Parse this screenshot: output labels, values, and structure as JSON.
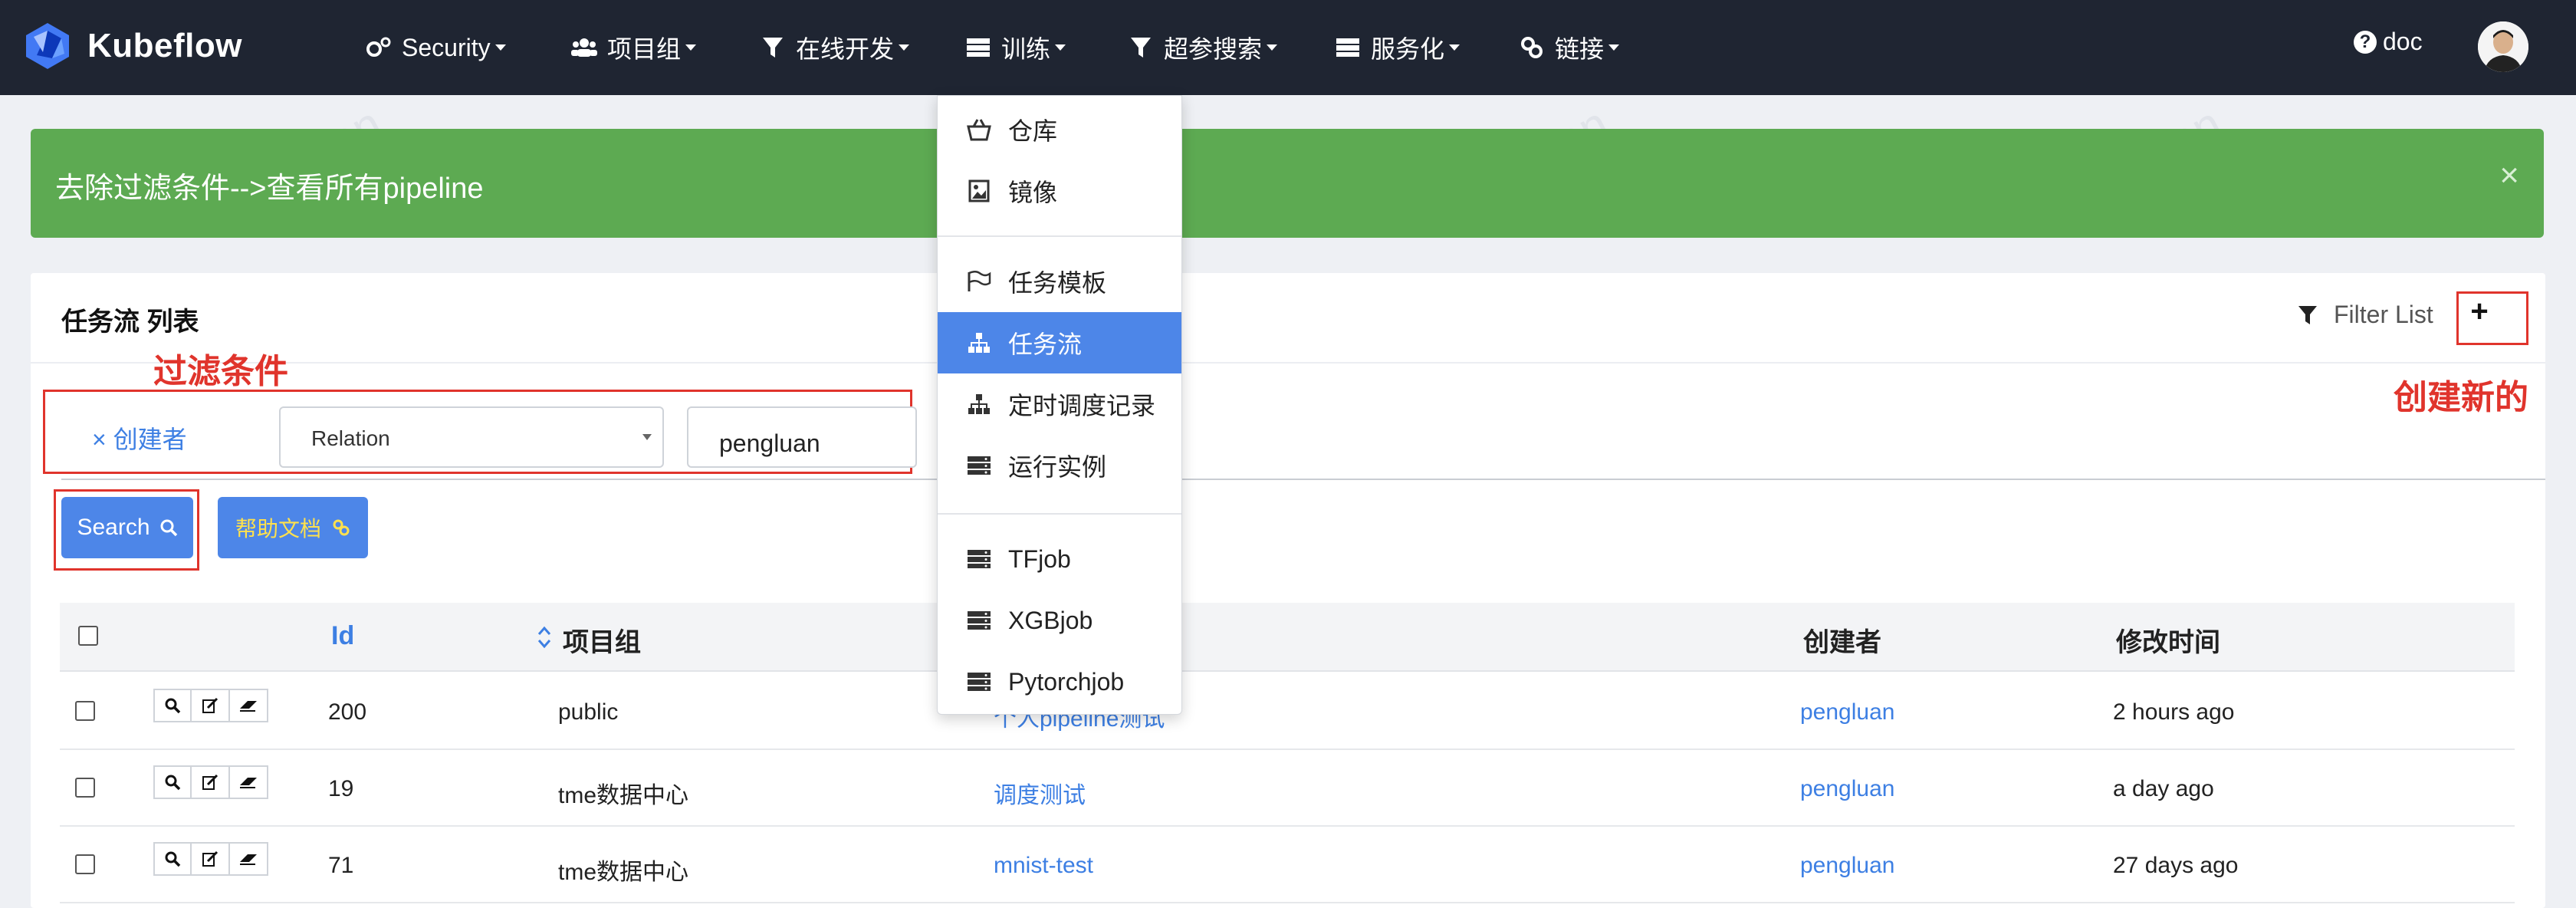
{
  "app": {
    "brand": "Kubeflow",
    "colors": {
      "navbar": "#1f2532",
      "accent": "#4d86e8",
      "alert": "#5daa52",
      "annotation": "#e0342c"
    }
  },
  "nav": {
    "items": [
      {
        "label": "Security",
        "icon": "gears-icon"
      },
      {
        "label": "项目组",
        "icon": "users-icon"
      },
      {
        "label": "在线开发",
        "icon": "filter-icon"
      },
      {
        "label": "训练",
        "icon": "server-icon"
      },
      {
        "label": "超参搜索",
        "icon": "filter-icon"
      },
      {
        "label": "服务化",
        "icon": "server-icon"
      },
      {
        "label": "链接",
        "icon": "link-icon"
      }
    ],
    "doc_label": "doc"
  },
  "alert": {
    "text": "去除过滤条件-->查看所有pipeline",
    "close": "×"
  },
  "panel": {
    "title": "任务流 列表",
    "filter_list_label": "Filter List",
    "add_label": "+"
  },
  "annotations": {
    "filter": "过滤条件",
    "create": "创建新的"
  },
  "filter": {
    "chip_label": "× 创建者",
    "relation_value": "Relation",
    "input_value": "pengluan"
  },
  "buttons": {
    "search": "Search",
    "help": "帮助文档"
  },
  "table": {
    "headers": {
      "id": "Id",
      "project": "项目组",
      "creator": "创建者",
      "modified": "修改时间"
    },
    "rows": [
      {
        "id": "200",
        "project": "public",
        "name": "个人pipeline测试",
        "creator": "pengluan",
        "modified": "2 hours ago"
      },
      {
        "id": "19",
        "project": "tme数据中心",
        "name": "调度测试",
        "creator": "pengluan",
        "modified": "a day ago"
      },
      {
        "id": "71",
        "project": "tme数据中心",
        "name": "mnist-test",
        "creator": "pengluan",
        "modified": "27 days ago"
      }
    ]
  },
  "dropdown": {
    "groups": [
      [
        {
          "label": "仓库",
          "icon": "basket-icon"
        },
        {
          "label": "镜像",
          "icon": "image-icon"
        }
      ],
      [
        {
          "label": "任务模板",
          "icon": "flag-icon"
        },
        {
          "label": "任务流",
          "icon": "sitemap-icon",
          "active": true
        },
        {
          "label": "定时调度记录",
          "icon": "sitemap-icon"
        },
        {
          "label": "运行实例",
          "icon": "server-icon"
        }
      ],
      [
        {
          "label": "TFjob",
          "icon": "server-icon"
        },
        {
          "label": "XGBjob",
          "icon": "server-icon"
        },
        {
          "label": "Pytorchjob",
          "icon": "server-icon"
        }
      ]
    ]
  },
  "watermark": {
    "line1": "pengluan",
    "line2": "@TME Kubeflow"
  }
}
